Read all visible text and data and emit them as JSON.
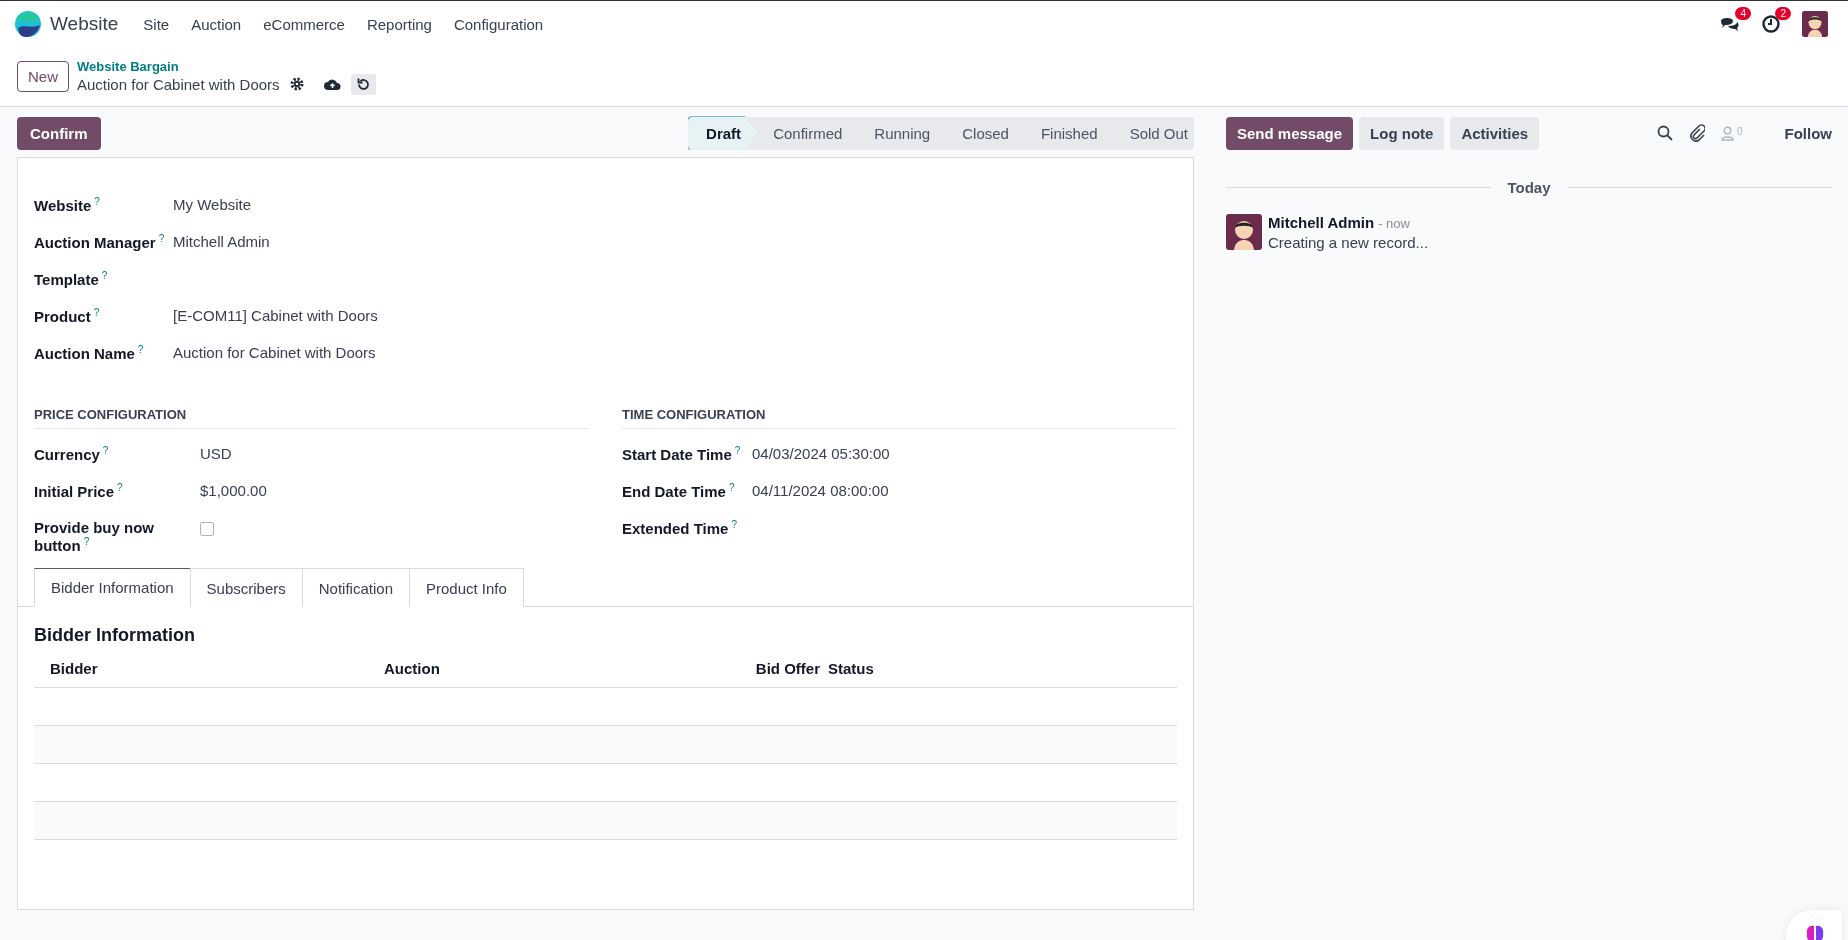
{
  "navbar": {
    "app_name": "Website",
    "menu": [
      "Site",
      "Auction",
      "eCommerce",
      "Reporting",
      "Configuration"
    ],
    "messages_badge": "4",
    "activities_badge": "2"
  },
  "control_panel": {
    "new_button": "New",
    "breadcrumb": "Website Bargain",
    "record_title": "Auction for Cabinet with Doors"
  },
  "actions": {
    "confirm_button": "Confirm"
  },
  "statusbar": [
    {
      "label": "Draft",
      "selected": true
    },
    {
      "label": "Confirmed",
      "selected": false
    },
    {
      "label": "Running",
      "selected": false
    },
    {
      "label": "Closed",
      "selected": false
    },
    {
      "label": "Finished",
      "selected": false
    },
    {
      "label": "Sold Out",
      "selected": false
    }
  ],
  "main_fields": [
    {
      "label": "Website",
      "help": "?",
      "value": "My Website"
    },
    {
      "label": "Auction Manager",
      "help": "?",
      "value": "Mitchell Admin"
    },
    {
      "label": "Template",
      "help": "?"
    },
    {
      "label": "Product",
      "help": "?",
      "value": "[E-COM11] Cabinet with Doors"
    },
    {
      "label": "Auction Name",
      "help": "?",
      "value": "Auction for Cabinet with Doors"
    }
  ],
  "groups": [
    {
      "title": "PRICE CONFIGURATION",
      "fields": [
        {
          "kind": "text",
          "label": "Currency",
          "help": "?",
          "value": "USD"
        },
        {
          "kind": "text",
          "label": "Initial Price",
          "help": "?",
          "value": "$1,000.00"
        },
        {
          "kind": "checkbox",
          "label": "Provide buy now button",
          "help": "?",
          "checked": false
        }
      ]
    },
    {
      "title": "TIME CONFIGURATION",
      "fields": [
        {
          "kind": "text",
          "label": "Start Date Time",
          "help": "?",
          "value": "04/03/2024 05:30:00"
        },
        {
          "kind": "text",
          "label": "End Date Time",
          "help": "?",
          "value": "04/11/2024 08:00:00"
        },
        {
          "kind": "text",
          "label": "Extended Time",
          "help": "?"
        }
      ]
    }
  ],
  "notebook": {
    "tabs": [
      {
        "label": "Bidder Information",
        "selected": true
      },
      {
        "label": "Subscribers",
        "selected": false
      },
      {
        "label": "Notification",
        "selected": false
      },
      {
        "label": "Product Info",
        "selected": false
      }
    ],
    "section_title": "Bidder Information",
    "columns": [
      "Bidder",
      "Auction",
      "Bid Offer",
      "Status"
    ]
  },
  "chatter": {
    "buttons": [
      {
        "label": "Send message",
        "selected": true
      },
      {
        "label": "Log note",
        "selected": false
      },
      {
        "label": "Activities",
        "selected": false
      }
    ],
    "followers_count": "0",
    "follow_button": "Follow",
    "date_separator": "Today",
    "messages": [
      {
        "author": "Mitchell Admin",
        "time": "- now",
        "body": "Creating a new record..."
      }
    ]
  }
}
